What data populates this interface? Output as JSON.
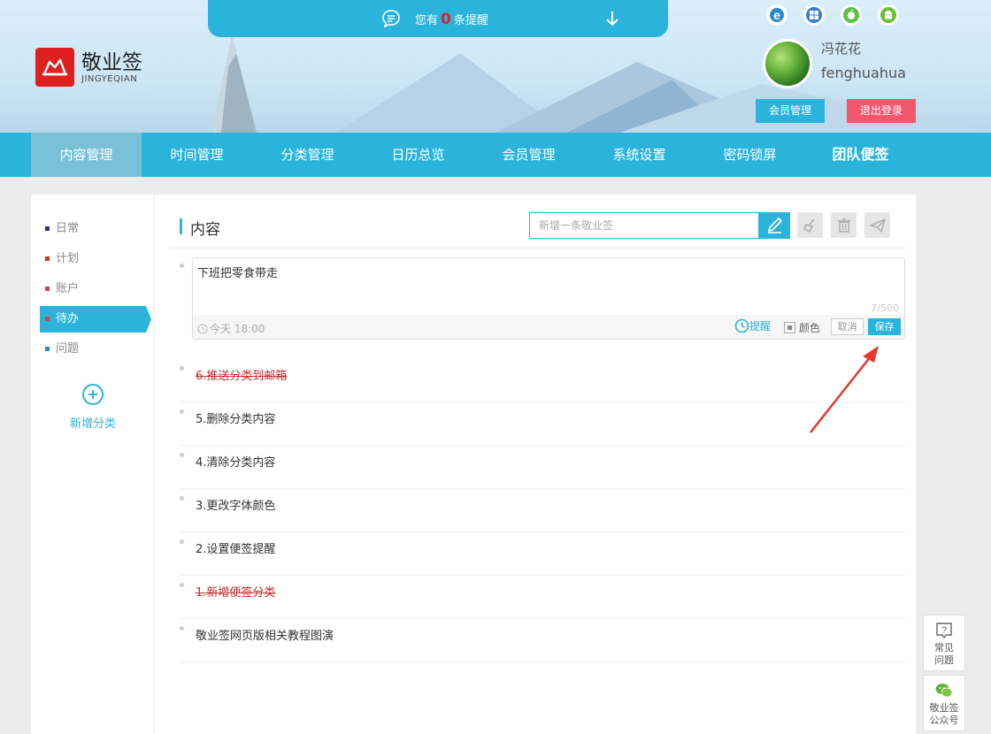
{
  "header": {
    "logo_cn": "敬业签",
    "logo_en": "JINGYEQIAN",
    "remind_prefix": "您有",
    "remind_count": "0",
    "remind_suffix": "条提醒",
    "platforms": [
      "ie-icon",
      "windows-icon",
      "apple-icon",
      "android-icon"
    ],
    "user_name": "冯花花",
    "user_id": "fenghuahua",
    "member_btn": "会员管理",
    "logout_btn": "退出登录"
  },
  "nav": {
    "items": [
      "内容管理",
      "时间管理",
      "分类管理",
      "日历总览",
      "会员管理",
      "系统设置",
      "密码锁屏",
      "团队便签"
    ]
  },
  "sidebar": {
    "categories": [
      {
        "label": "日常",
        "color": "#3a2a8a"
      },
      {
        "label": "计划",
        "color": "#d03020"
      },
      {
        "label": "账户",
        "color": "#d04050"
      },
      {
        "label": "待办",
        "color": "#e04030"
      },
      {
        "label": "问题",
        "color": "#2a8ad0"
      }
    ],
    "add_label": "新增分类"
  },
  "main": {
    "title": "内容",
    "search_placeholder": "新增一条敬业签"
  },
  "editor": {
    "text": "下班把零食带走",
    "count": "7/500",
    "time": "今天 18:00",
    "remind": "提醒",
    "color": "颜色",
    "cancel": "取消",
    "save": "保存"
  },
  "list": [
    {
      "text": "6.推送分类到邮箱",
      "done": true
    },
    {
      "text": "5.删除分类内容",
      "done": false
    },
    {
      "text": "4.清除分类内容",
      "done": false
    },
    {
      "text": "3.更改字体颜色",
      "done": false
    },
    {
      "text": "2.设置便签提醒",
      "done": false
    },
    {
      "text": "1.新增便签分类",
      "done": true
    },
    {
      "text": "敬业签网页版相关教程图演",
      "done": false
    }
  ],
  "float": {
    "faq_line1": "常见",
    "faq_line2": "问题",
    "wechat_line1": "敬业签",
    "wechat_line2": "公众号"
  },
  "colors": {
    "accent": "#2ab4dc",
    "logout": "#f2576e",
    "logo": "#e02020"
  }
}
